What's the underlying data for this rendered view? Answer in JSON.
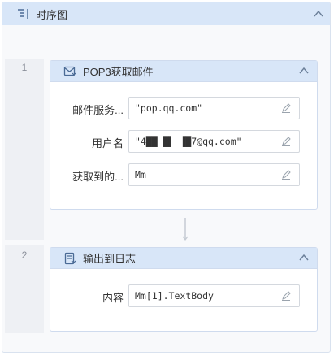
{
  "panel": {
    "title": "时序图"
  },
  "steps": [
    {
      "number": "1",
      "title": "POP3获取邮件",
      "fields": [
        {
          "label": "邮件服务...",
          "value": "\"pop.qq.com\""
        },
        {
          "label": "用户名",
          "value": "\"4██ █▌ ▐█7@qq.com\""
        },
        {
          "label": "获取到的...",
          "value": "Mm"
        }
      ]
    },
    {
      "number": "2",
      "title": "输出到日志",
      "fields": [
        {
          "label": "内容",
          "value": "Mm[1].TextBody"
        }
      ]
    }
  ],
  "icons": {
    "panel": "sequence-diagram-icon",
    "step1": "mail-receive-icon",
    "step2": "log-output-icon",
    "collapse": "chevron-up-icon",
    "edit": "pencil-icon"
  },
  "colors": {
    "header": "#d8e6f8",
    "border": "#cfdbee",
    "accent": "#3a7fd6"
  }
}
